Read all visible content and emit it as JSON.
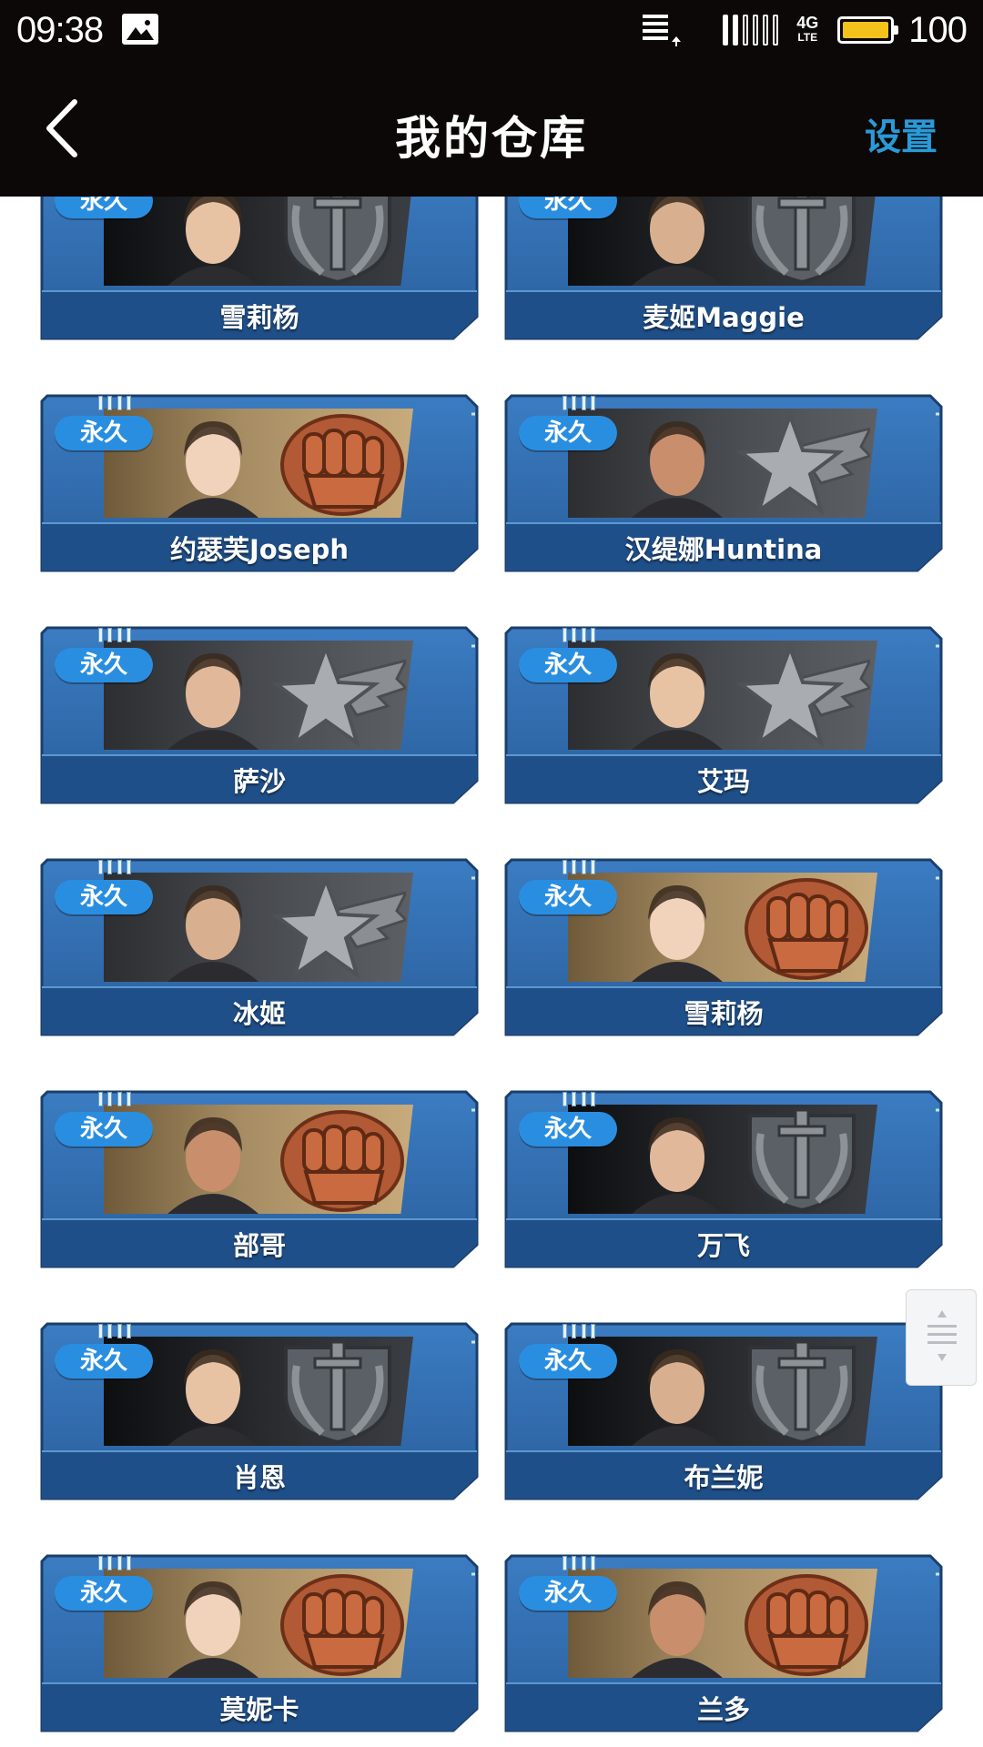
{
  "status_bar": {
    "time": "09:38",
    "network_top": "4G",
    "network_bottom": "LTE",
    "battery_level": "100",
    "battery_fill": 1.0,
    "battery_color": "#f5c21b",
    "signal_bars_on": 2,
    "signal_bars_total": 6
  },
  "nav": {
    "back_icon": "chevron-left-icon",
    "title": "我的仓库",
    "settings_label": "设置",
    "settings_color": "#2a9ad8"
  },
  "colors": {
    "card_blue": "#2f67a6",
    "card_blue_dark": "#1d4c82",
    "badge_blue": "#2a8ee0"
  },
  "cards": [
    {
      "badge": "永久",
      "name": "雪莉杨",
      "emblem": "sword-wreath-icon",
      "portrait_bg": "dark"
    },
    {
      "badge": "永久",
      "name": "麦姬Maggie",
      "emblem": "sword-wreath-icon",
      "portrait_bg": "dark"
    },
    {
      "badge": "永久",
      "name": "约瑟芙Joseph",
      "emblem": "fist-icon",
      "portrait_bg": "tan"
    },
    {
      "badge": "永久",
      "name": "汉缇娜Huntina",
      "emblem": "winged-star-icon",
      "portrait_bg": "gray"
    },
    {
      "badge": "永久",
      "name": "萨沙",
      "emblem": "winged-star-icon",
      "portrait_bg": "gray"
    },
    {
      "badge": "永久",
      "name": "艾玛",
      "emblem": "winged-star-icon",
      "portrait_bg": "gray"
    },
    {
      "badge": "永久",
      "name": "冰姬",
      "emblem": "winged-star-icon",
      "portrait_bg": "gray"
    },
    {
      "badge": "永久",
      "name": "雪莉杨",
      "emblem": "fist-icon",
      "portrait_bg": "tan"
    },
    {
      "badge": "永久",
      "name": "部哥",
      "emblem": "fist-icon",
      "portrait_bg": "tan"
    },
    {
      "badge": "永久",
      "name": "万飞",
      "emblem": "sword-wreath-icon",
      "portrait_bg": "dark"
    },
    {
      "badge": "永久",
      "name": "肖恩",
      "emblem": "sword-wreath-icon",
      "portrait_bg": "dark"
    },
    {
      "badge": "永久",
      "name": "布兰妮",
      "emblem": "sword-wreath-icon",
      "portrait_bg": "dark"
    },
    {
      "badge": "永久",
      "name": "莫妮卡",
      "emblem": "fist-icon",
      "portrait_bg": "tan"
    },
    {
      "badge": "永久",
      "name": "兰多",
      "emblem": "fist-icon",
      "portrait_bg": "tan"
    }
  ],
  "scroll_handle": {
    "icon": "scroll-handle-icon"
  }
}
